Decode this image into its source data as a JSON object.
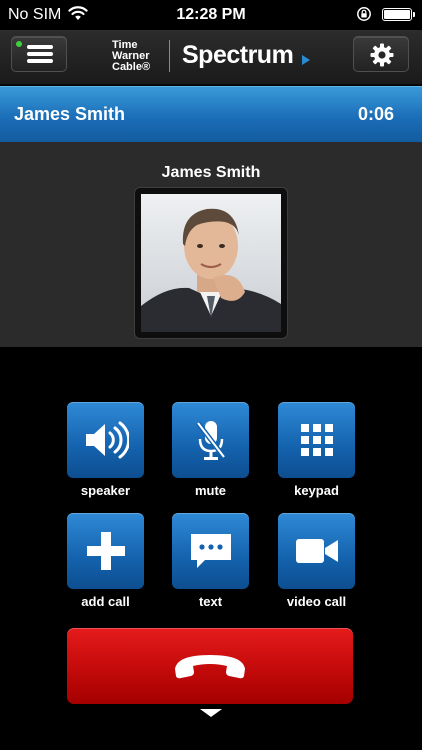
{
  "status_bar": {
    "carrier": "No SIM",
    "time": "12:28 PM",
    "battery_level": 1.0
  },
  "header": {
    "menu_icon": "hamburger-menu-icon",
    "status_dot_color": "#3ed13e",
    "logo_twc_lines": [
      "Time",
      "Warner",
      "Cable®"
    ],
    "logo_spectrum": "Spectrum",
    "settings_icon": "gear-icon"
  },
  "call_bar": {
    "name": "James Smith",
    "duration": "0:06",
    "color": "#1b6eb8"
  },
  "contact": {
    "name": "James Smith"
  },
  "actions": [
    {
      "label": "speaker",
      "icon": "speaker-icon"
    },
    {
      "label": "mute",
      "icon": "microphone-muted-icon"
    },
    {
      "label": "keypad",
      "icon": "keypad-icon"
    },
    {
      "label": "add call",
      "icon": "plus-icon"
    },
    {
      "label": "text",
      "icon": "chat-bubble-icon"
    },
    {
      "label": "video call",
      "icon": "video-camera-icon"
    }
  ],
  "end_call": {
    "icon": "hang-up-phone-icon",
    "color": "#c30a0a"
  },
  "collapse_icon": "chevron-down-icon"
}
